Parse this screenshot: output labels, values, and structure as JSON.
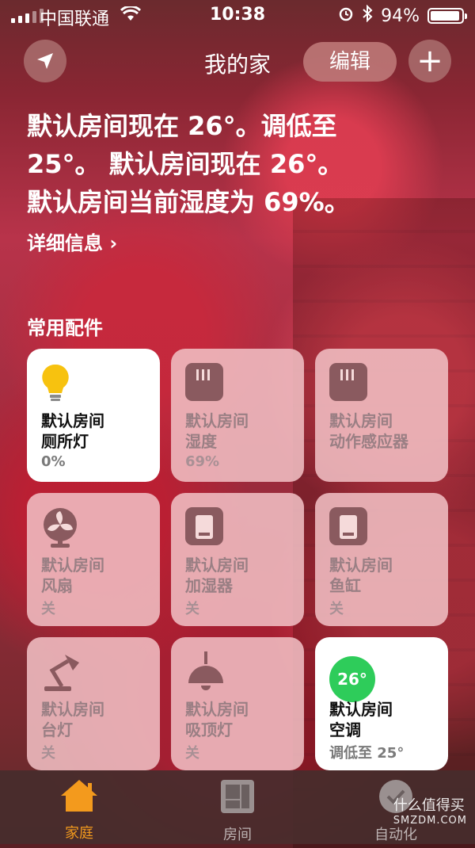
{
  "status": {
    "carrier": "中国联通",
    "time": "10:38",
    "battery": "94%",
    "battery_level": 0.94
  },
  "nav": {
    "title": "我的家",
    "edit_label": "编辑",
    "add_label": "+"
  },
  "summary": {
    "line1": "默认房间现在 26°。调低至",
    "line2": "25°。 默认房间现在 26°。",
    "line3": "默认房间当前湿度为 69%。",
    "details_label": "详细信息 ›"
  },
  "section_title": "常用配件",
  "tiles": [
    {
      "room": "默认房间",
      "name": "厕所灯",
      "status": "0%",
      "icon": "bulb-icon",
      "on": true
    },
    {
      "room": "默认房间",
      "name": "湿度",
      "status": "69%",
      "icon": "humidity-sensor-icon",
      "on": false
    },
    {
      "room": "默认房间",
      "name": "动作感应器",
      "status": "",
      "icon": "motion-sensor-icon",
      "on": false
    },
    {
      "room": "默认房间",
      "name": "风扇",
      "status": "关",
      "icon": "fan-icon",
      "on": false
    },
    {
      "room": "默认房间",
      "name": "加湿器",
      "status": "关",
      "icon": "switch-icon",
      "on": false
    },
    {
      "room": "默认房间",
      "name": "鱼缸",
      "status": "关",
      "icon": "switch-icon",
      "on": false
    },
    {
      "room": "默认房间",
      "name": "台灯",
      "status": "关",
      "icon": "desk-lamp-icon",
      "on": false
    },
    {
      "room": "默认房间",
      "name": "吸顶灯",
      "status": "关",
      "icon": "ceiling-lamp-icon",
      "on": false
    },
    {
      "room": "默认房间",
      "name": "空调",
      "status": "调低至 25°",
      "icon": "thermostat-icon",
      "badge": "26°",
      "on": true
    }
  ],
  "tabbar": {
    "home_label": "家庭",
    "rooms_label": "房间",
    "automation_label": "自动化",
    "active_color": "#f39a1d"
  },
  "watermark": {
    "line1": "什么值得买",
    "line2": "SMZDM.COM"
  }
}
